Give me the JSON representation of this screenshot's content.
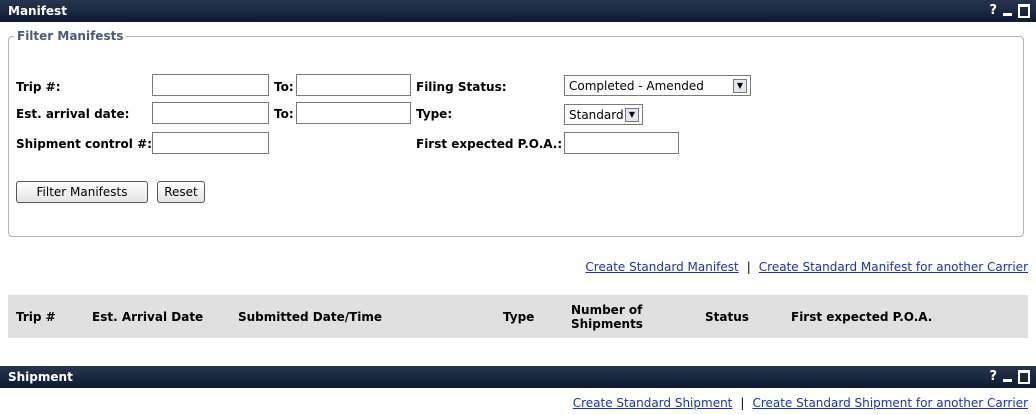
{
  "manifest_panel": {
    "title": "Manifest",
    "help": "?"
  },
  "filter": {
    "legend": "Filter Manifests",
    "trip_label": "Trip #:",
    "to_label": "To:",
    "filing_status_label": "Filing Status:",
    "filing_status_value": "Completed - Amended",
    "est_arrival_label": "Est. arrival date:",
    "type_label": "Type:",
    "type_value": "Standard",
    "shipment_control_label": "Shipment control #:",
    "first_poa_label": "First expected P.O.A.:",
    "filter_button": "Filter Manifests",
    "reset_button": "Reset"
  },
  "manifest_links": {
    "create": "Create Standard Manifest",
    "separator": "|",
    "create_other": "Create Standard Manifest for another Carrier"
  },
  "table": {
    "columns": [
      "Trip #",
      "Est. Arrival Date",
      "Submitted Date/Time",
      "Type",
      "Number of Shipments",
      "Status",
      "First expected P.O.A."
    ]
  },
  "shipment_panel": {
    "title": "Shipment",
    "help": "?"
  },
  "shipment_links": {
    "create": "Create Standard Shipment",
    "separator": "|",
    "create_other": "Create Standard Shipment for another Carrier"
  },
  "icons": {
    "dropdown": "chevron-down-icon",
    "minimize": "minimize-icon",
    "maximize": "maximize-icon"
  }
}
